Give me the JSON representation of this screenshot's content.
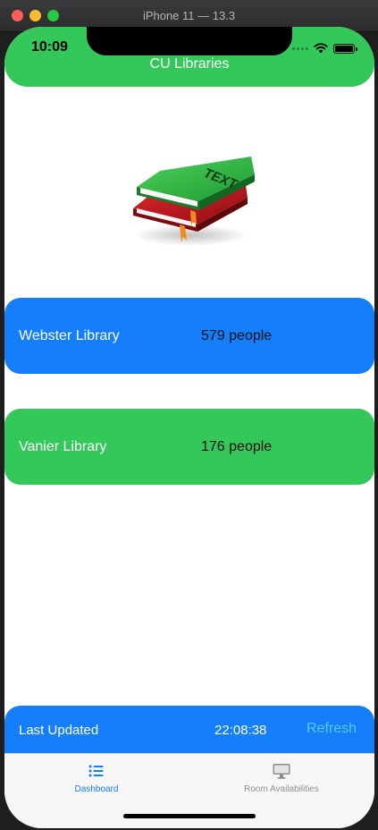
{
  "window": {
    "title": "iPhone 11 — 13.3"
  },
  "status_bar": {
    "time": "10:09"
  },
  "header": {
    "title": "CU Libraries"
  },
  "logo": {
    "text": "TEXT"
  },
  "libraries": [
    {
      "name": "Webster Library",
      "count": "579 people",
      "color": "#147efb"
    },
    {
      "name": "Vanier Library",
      "count": "176 people",
      "color": "#34c759"
    }
  ],
  "update": {
    "label": "Last Updated",
    "time": "22:08:38",
    "refresh_label": "Refresh"
  },
  "tabs": [
    {
      "label": "Dashboard",
      "icon": "list-icon",
      "active": true
    },
    {
      "label": "Room Availabilities",
      "icon": "desktop-icon",
      "active": false
    }
  ],
  "colors": {
    "green": "#34c759",
    "blue": "#147efb",
    "refresh": "#5ac8fa"
  }
}
